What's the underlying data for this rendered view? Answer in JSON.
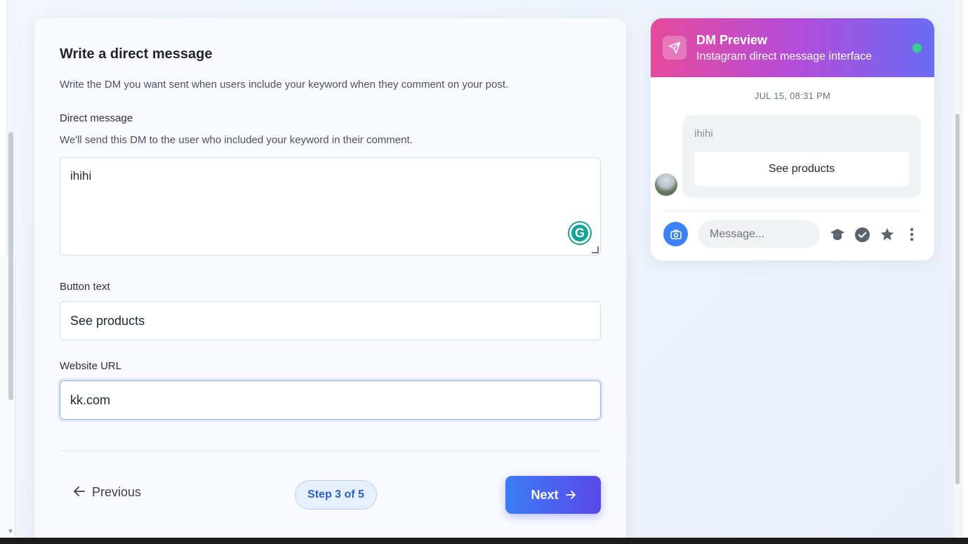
{
  "form": {
    "title": "Write a direct message",
    "description": "Write the DM you want sent when users include your keyword when they comment on your post.",
    "direct_message": {
      "label": "Direct message",
      "help": "We'll send this DM to the user who included your keyword in their comment.",
      "value": "ihihi"
    },
    "button_text": {
      "label": "Button text",
      "value": "See products"
    },
    "website_url": {
      "label": "Website URL",
      "value": "kk.com"
    },
    "nav": {
      "previous_label": "Previous",
      "step_label": "Step 3 of 5",
      "next_label": "Next"
    }
  },
  "preview": {
    "title": "DM Preview",
    "subtitle": "Instagram direct message interface",
    "timestamp": "JUL 15, 08:31 PM",
    "message_text": "ihihi",
    "button_label": "See products",
    "composer_placeholder": "Message...",
    "icons": [
      "send-icon",
      "camera-icon",
      "graduation-cap-icon",
      "check-circle-icon",
      "star-icon",
      "more-vertical-icon"
    ]
  },
  "colors": {
    "accent": "#3b7cf5",
    "preview_gradient_start": "#e64b9c",
    "preview_gradient_end": "#6a6cf4",
    "online": "#3ccf8e"
  }
}
